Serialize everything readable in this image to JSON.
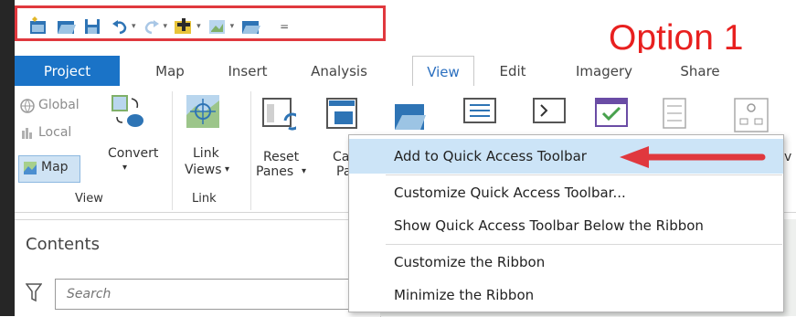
{
  "quick_access_toolbar": {
    "icons": [
      "new-project-icon",
      "open-project-icon",
      "save-project-icon",
      "undo-icon",
      "redo-icon",
      "add-data-icon",
      "add-preset-icon",
      "open-folder-icon",
      "customize-dropdown-icon"
    ],
    "more_glyph": "="
  },
  "annotation": {
    "label": "Option 1",
    "color": "#e8201f"
  },
  "tabs": {
    "items": [
      {
        "label": "Project"
      },
      {
        "label": "Map"
      },
      {
        "label": "Insert"
      },
      {
        "label": "Analysis"
      },
      {
        "label": "View"
      },
      {
        "label": "Edit"
      },
      {
        "label": "Imagery"
      },
      {
        "label": "Share"
      }
    ],
    "active": "View"
  },
  "ribbon": {
    "view_group": {
      "global": "Global",
      "local": "Local",
      "map": "Map",
      "convert": "Convert",
      "label": "View"
    },
    "link_group": {
      "link_line1": "Link",
      "link_line2": "Views",
      "label": "Link"
    },
    "windows_group": {
      "reset_line1": "Reset",
      "reset_line2": "Panes",
      "cata_line1": "Cata",
      "cata_line2": "Pa"
    },
    "partial_right": "v"
  },
  "context_menu": {
    "items": [
      {
        "label": "Add to Quick Access Toolbar"
      },
      {
        "label": "Customize Quick Access Toolbar..."
      },
      {
        "label": "Show Quick Access Toolbar Below the Ribbon"
      },
      {
        "label": "Customize the Ribbon"
      },
      {
        "label": "Minimize the Ribbon"
      }
    ],
    "highlight_color": "#cce4f7"
  },
  "contents": {
    "title": "Contents",
    "search_placeholder": "Search"
  },
  "colors": {
    "accent": "#1a73c7",
    "annotation_red": "#e0383e"
  }
}
